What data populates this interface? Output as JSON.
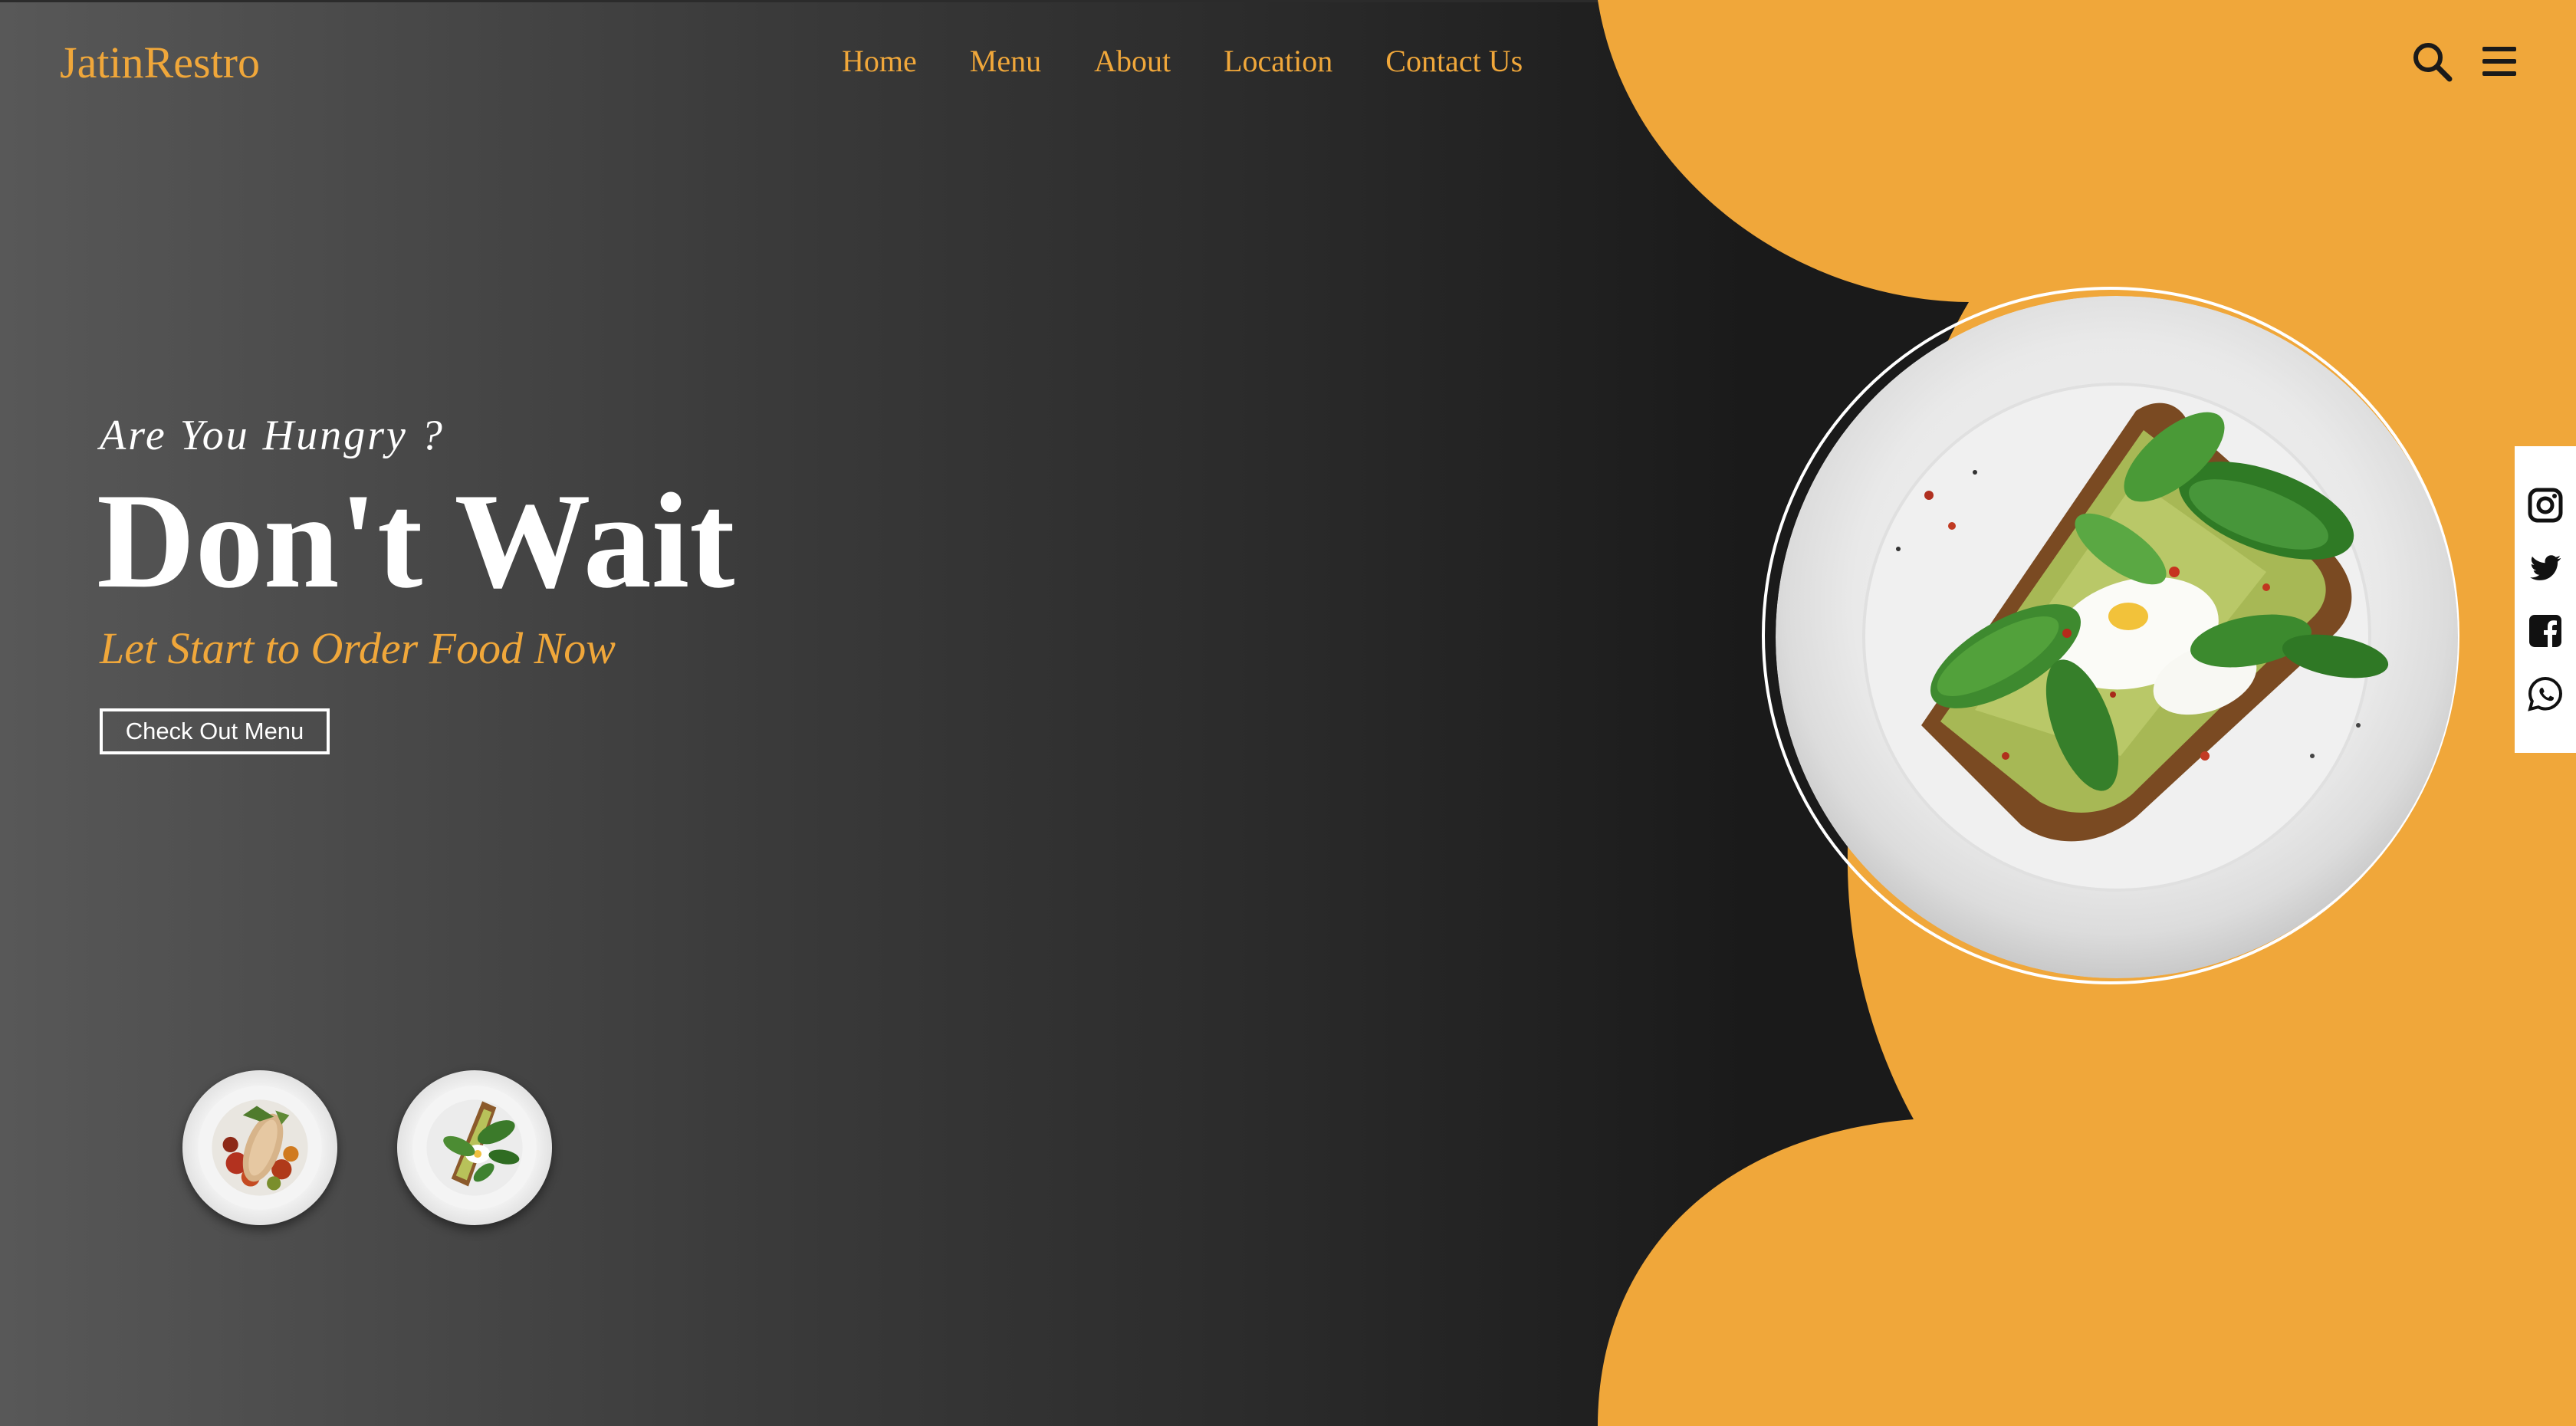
{
  "brand": {
    "logo_text": "JatinRestro",
    "accent_color": "#f0a73a"
  },
  "nav": {
    "items": [
      {
        "label": "Home"
      },
      {
        "label": "Menu"
      },
      {
        "label": "About"
      },
      {
        "label": "Location"
      },
      {
        "label": "Contact Us"
      }
    ]
  },
  "header_icons": [
    "search-icon",
    "hamburger-menu-icon"
  ],
  "hero": {
    "subtitle": "Are You Hungry ?",
    "title": "Don't Wait",
    "tagline": "Let Start to Order Food Now",
    "cta_label": "Check Out Menu"
  },
  "thumbnails": [
    {
      "name": "chicken-vegetable-dish-thumbnail"
    },
    {
      "name": "avocado-toast-thumbnail"
    }
  ],
  "featured_dish": {
    "name": "avocado-toast-spinach-egg-plate"
  },
  "social": [
    "instagram-icon",
    "twitter-icon",
    "facebook-icon",
    "whatsapp-icon"
  ],
  "colors": {
    "orange": "#f0a73a",
    "dark": "#1a1a1a",
    "white": "#ffffff"
  }
}
